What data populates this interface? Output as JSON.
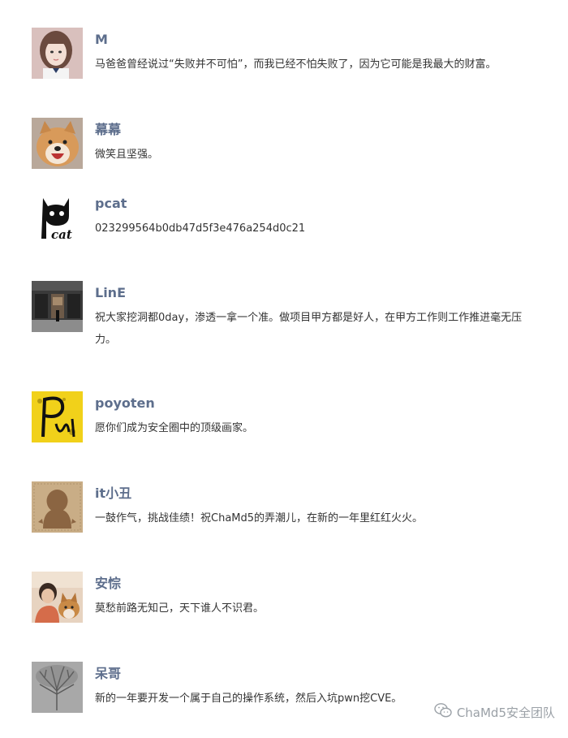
{
  "comments": [
    {
      "name": "M",
      "text": "马爸爸曾经说过“失败并不可怕”，而我已经不怕失败了，因为它可能是我最大的财富。",
      "avatar": "girl-photo-avatar"
    },
    {
      "name": "幕幕",
      "text": "微笑且坚强。",
      "avatar": "shiba-dog-avatar"
    },
    {
      "name": "pcat",
      "text": "023299564b0db47d5f3e476a254d0c21",
      "avatar": "pcat-cat-logo-avatar",
      "avatar_text": "cat"
    },
    {
      "name": "LinE",
      "text": "祝大家挖洞都0day，渗透一拿一个准。做项目甲方都是好人，在甲方工作则工作推进毫无压力。",
      "avatar": "street-storefront-avatar"
    },
    {
      "name": "poyoten",
      "text": "愿你们成为安全圈中的顶级画家。",
      "avatar": "yellow-scribble-avatar"
    },
    {
      "name": "it小丑",
      "text": "一鼓作气，挑战佳绩！祝ChaMd5的弄潮儿，在新的一年里红红火火。",
      "avatar": "default-penguin-avatar"
    },
    {
      "name": "安悰",
      "text": "莫愁前路无知己，天下谁人不识君。",
      "avatar": "person-with-dog-avatar"
    },
    {
      "name": "呆哥",
      "text": "新的一年要开发一个属于自己的操作系统，然后入坑pwn挖CVE。",
      "avatar": "gray-tree-avatar"
    }
  ],
  "watermark": {
    "label": "ChaMd5安全团队",
    "icon": "wechat-icon"
  },
  "colors": {
    "name": "#5d6e8c",
    "text": "#333333",
    "watermark": "#9aa0a6"
  }
}
